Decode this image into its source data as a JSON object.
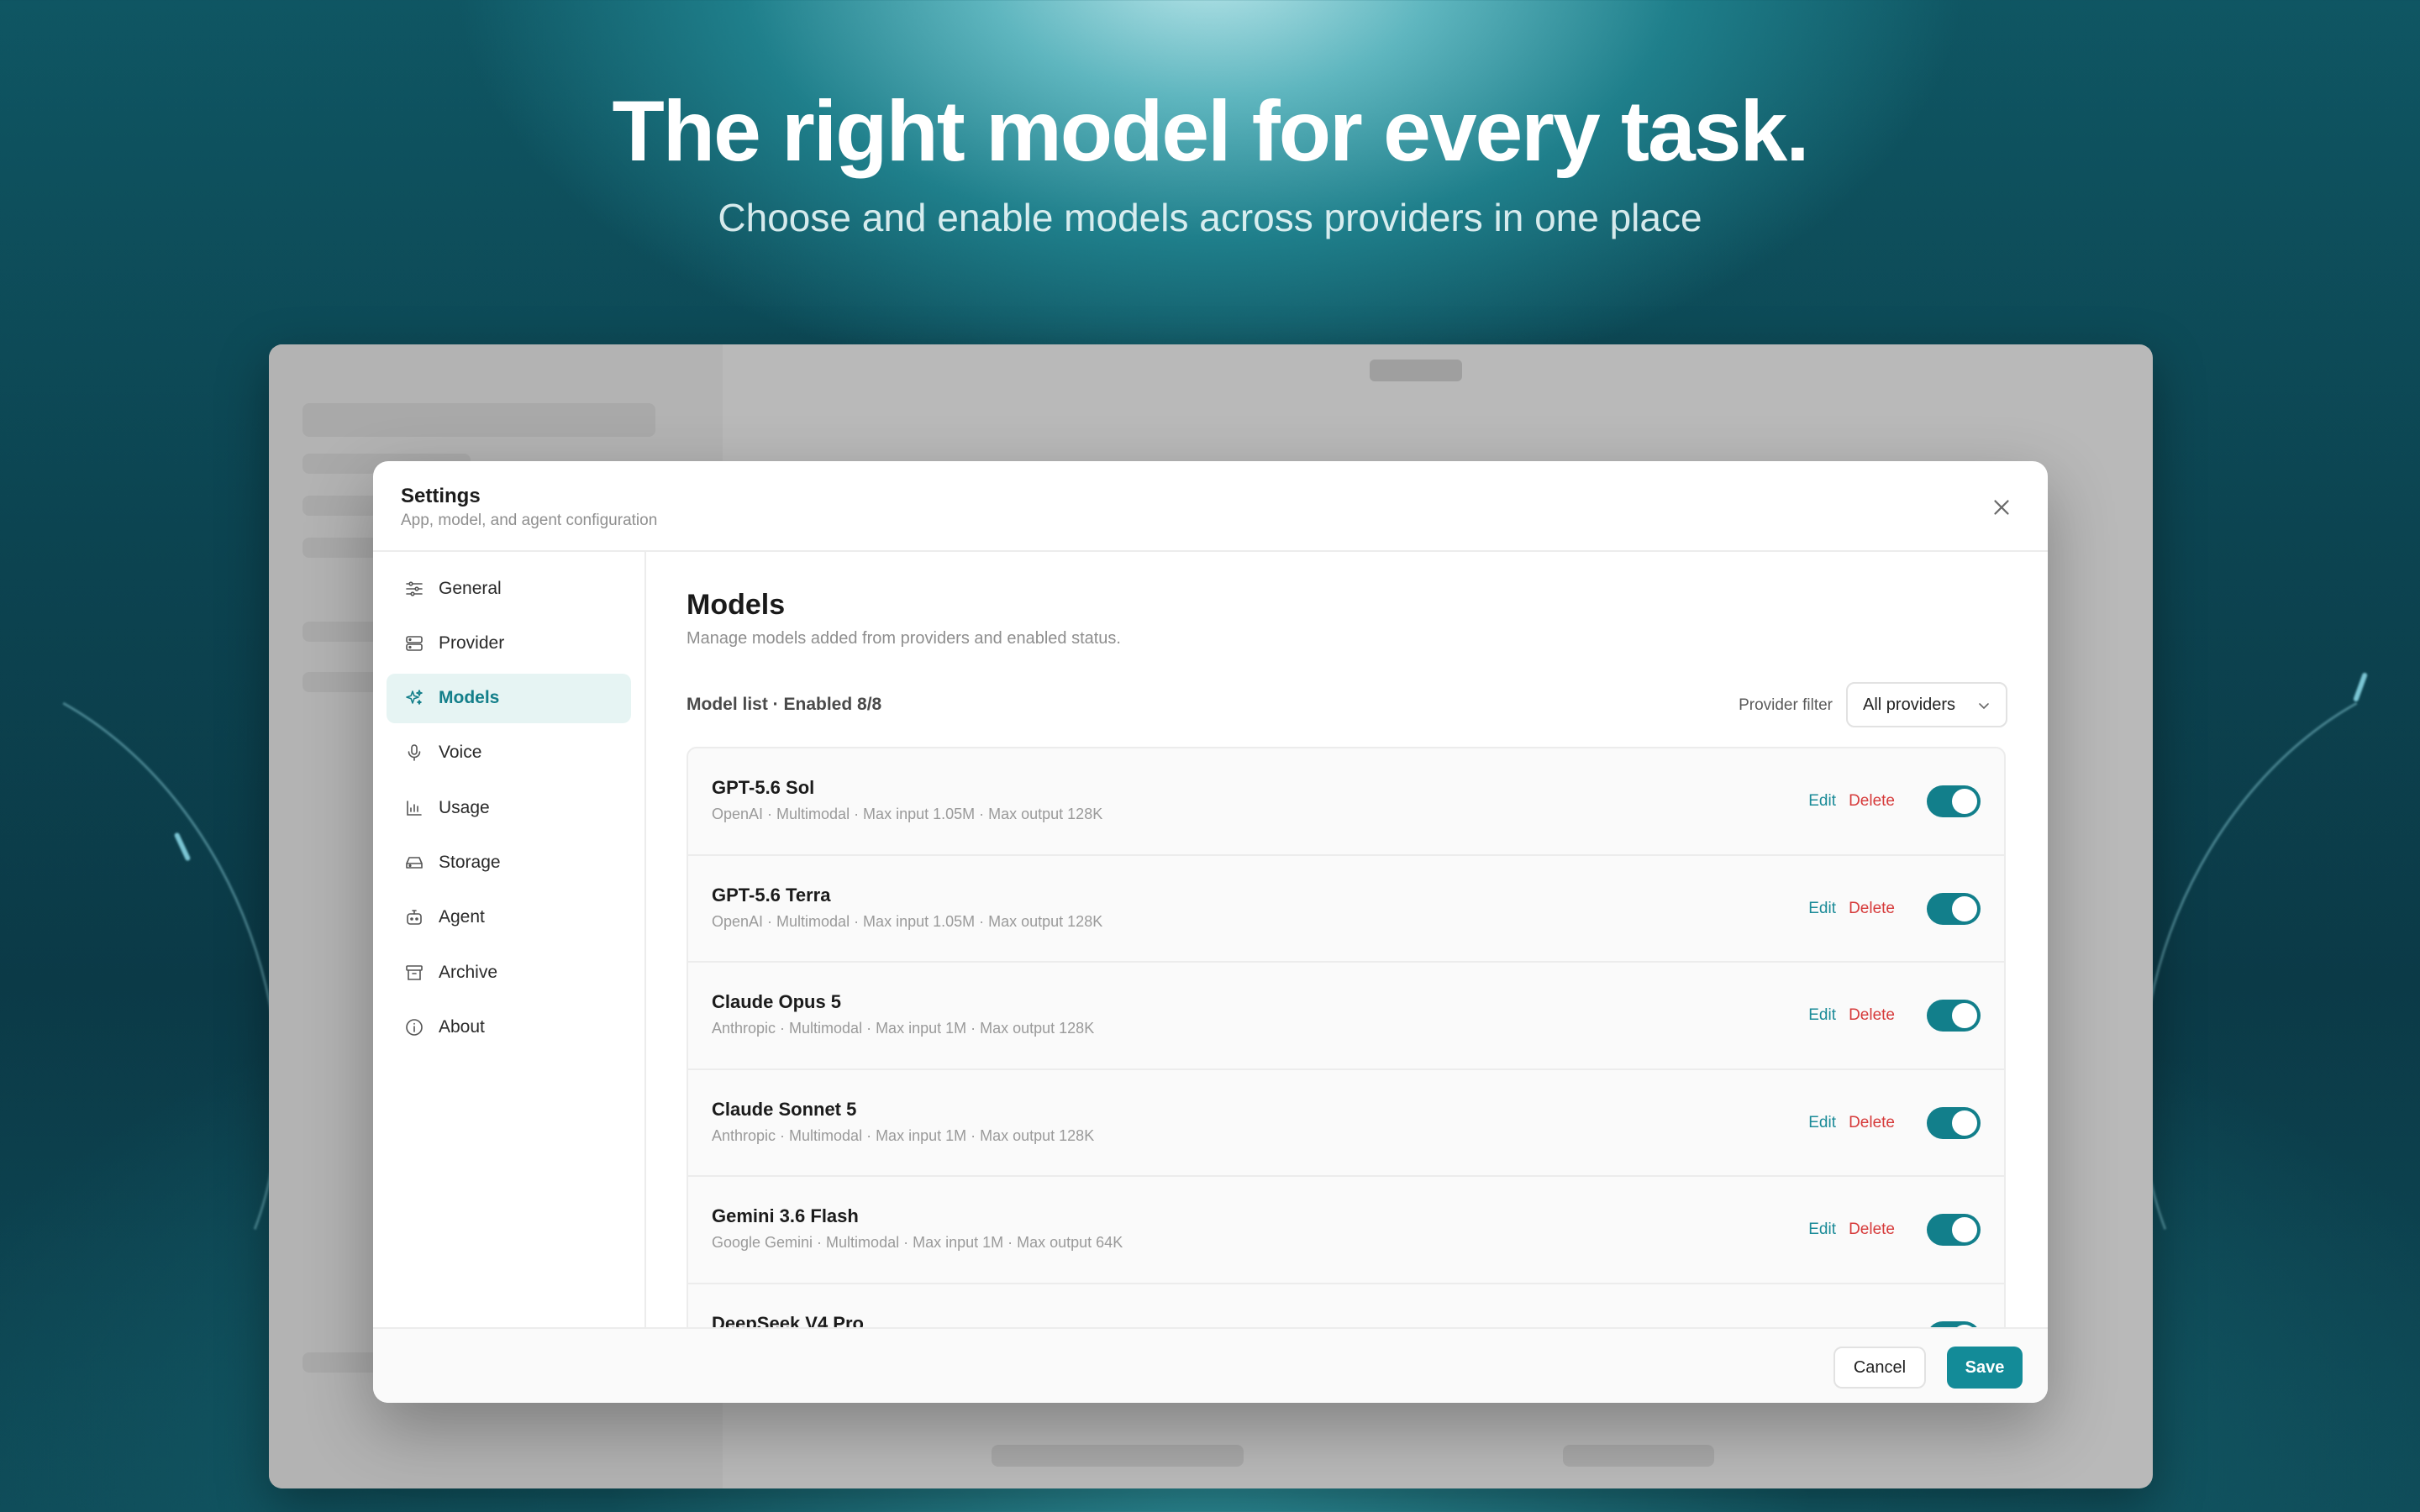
{
  "hero": {
    "title": "The right model for every task.",
    "subtitle": "Choose and enable models across providers in one place"
  },
  "settings": {
    "title": "Settings",
    "subtitle": "App, model, and agent configuration",
    "close_icon": "close-icon"
  },
  "nav": {
    "items": [
      {
        "label": "General",
        "icon": "sliders-icon"
      },
      {
        "label": "Provider",
        "icon": "server-icon"
      },
      {
        "label": "Models",
        "icon": "sparkles-icon",
        "active": true
      },
      {
        "label": "Voice",
        "icon": "microphone-icon"
      },
      {
        "label": "Usage",
        "icon": "bar-chart-icon"
      },
      {
        "label": "Storage",
        "icon": "hard-drive-icon"
      },
      {
        "label": "Agent",
        "icon": "bot-icon"
      },
      {
        "label": "Archive",
        "icon": "archive-icon"
      },
      {
        "label": "About",
        "icon": "info-icon"
      }
    ]
  },
  "models_page": {
    "title": "Models",
    "description": "Manage models added from providers and enabled status.",
    "list_label": "Model list · Enabled 8/8",
    "filter_label": "Provider filter",
    "filter_value": "All providers",
    "edit_label": "Edit",
    "delete_label": "Delete",
    "rows": [
      {
        "name": "GPT-5.6 Sol",
        "meta": "OpenAI · Multimodal · Max input 1.05M · Max output 128K",
        "enabled": true
      },
      {
        "name": "GPT-5.6 Terra",
        "meta": "OpenAI · Multimodal · Max input 1.05M · Max output 128K",
        "enabled": true
      },
      {
        "name": "Claude Opus 5",
        "meta": "Anthropic · Multimodal · Max input 1M · Max output 128K",
        "enabled": true
      },
      {
        "name": "Claude Sonnet 5",
        "meta": "Anthropic · Multimodal · Max input 1M · Max output 128K",
        "enabled": true
      },
      {
        "name": "Gemini 3.6 Flash",
        "meta": "Google Gemini · Multimodal · Max input 1M · Max output 64K",
        "enabled": true
      },
      {
        "name": "DeepSeek V4 Pro",
        "meta": "",
        "enabled": true
      }
    ]
  },
  "footer": {
    "cancel_label": "Cancel",
    "save_label": "Save"
  },
  "colors": {
    "accent": "#138b98",
    "danger": "#d63a3a",
    "active_nav_bg": "#e6f4f3"
  }
}
